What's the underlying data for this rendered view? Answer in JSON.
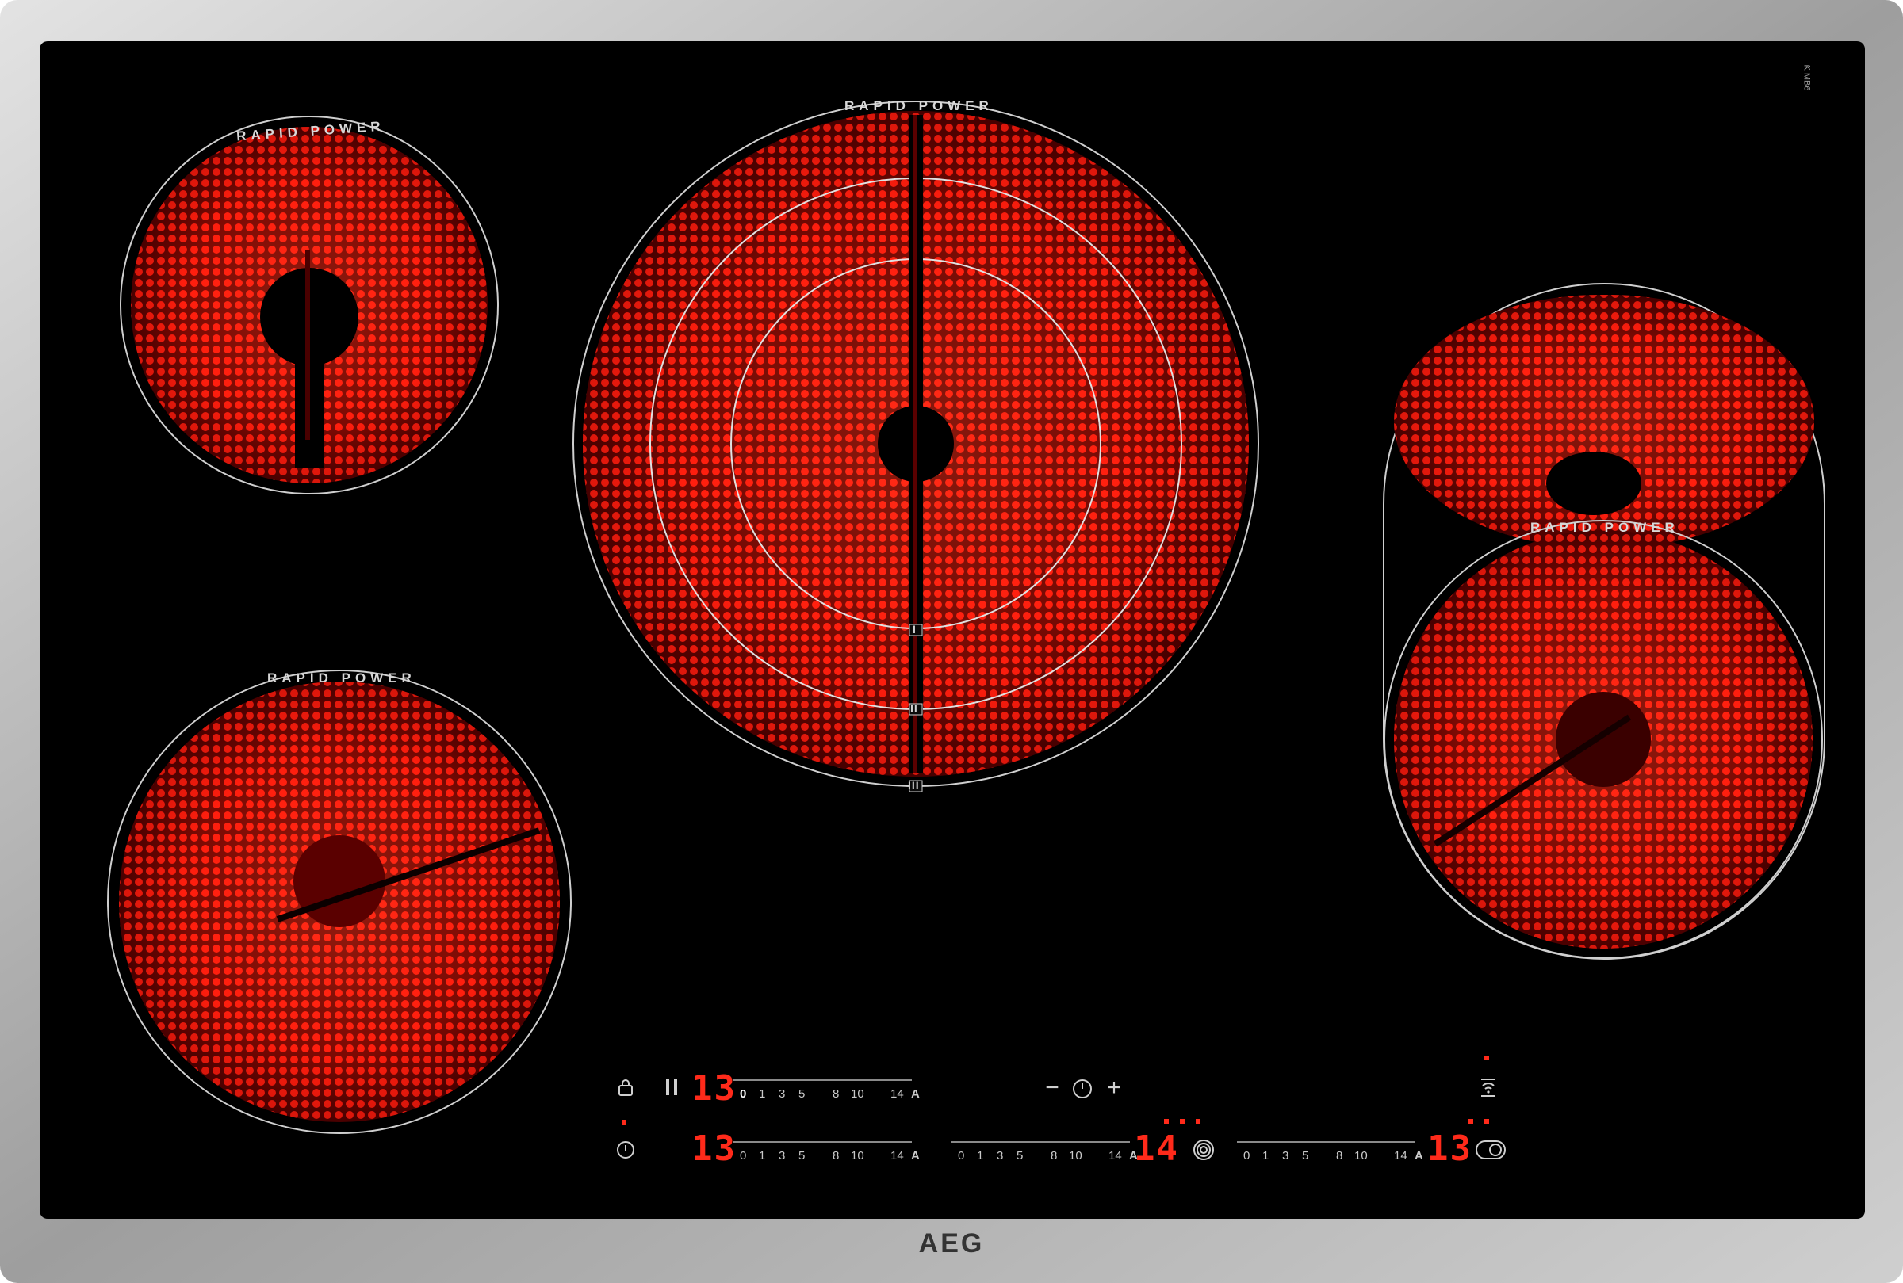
{
  "brand": "AEG",
  "corner_mark": "Ƙ MB6",
  "zones": [
    {
      "id": "front-left-top",
      "label": "RAPID POWER"
    },
    {
      "id": "center",
      "label": "RAPID POWER",
      "rings": [
        "I",
        "II",
        "III"
      ]
    },
    {
      "id": "right-oval",
      "label": "RAPID POWER"
    },
    {
      "id": "front-left-bottom",
      "label": "RAPID POWER"
    }
  ],
  "scale_ticks": [
    "0",
    "1",
    "3",
    "5",
    "8",
    "10",
    "14"
  ],
  "scale_unit": "A",
  "controls": {
    "top_row": {
      "level": "13",
      "selected_tick": "0"
    },
    "timer": {
      "minus": "−",
      "plus": "+"
    },
    "bottom_left": {
      "level": "13"
    },
    "bottom_center": {
      "level": "14"
    },
    "bottom_right": {
      "level": "13"
    }
  },
  "colors": {
    "glass": "#000000",
    "frame": "#b9b9b9",
    "element_red": "#ff1e10",
    "display_red": "#ff2a1a"
  },
  "icons": {
    "lock": "lock-icon",
    "pause": "pause-icon",
    "power": "power-icon",
    "timer": "timer-icon",
    "hob2hood": "hood-connect-icon",
    "multizone": "multi-zone-icon",
    "bridge": "bridge-zone-icon"
  }
}
